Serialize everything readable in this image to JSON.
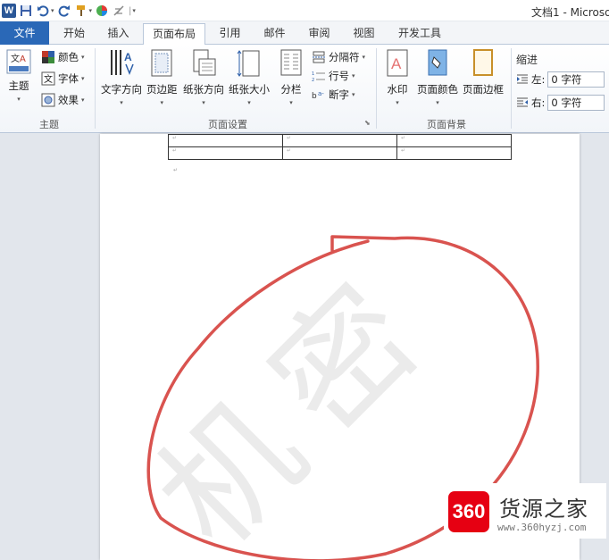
{
  "titlebar": {
    "title": "文档1 - Microso"
  },
  "tabs": [
    {
      "label": "文件"
    },
    {
      "label": "开始"
    },
    {
      "label": "插入"
    },
    {
      "label": "页面布局"
    },
    {
      "label": "引用"
    },
    {
      "label": "邮件"
    },
    {
      "label": "审阅"
    },
    {
      "label": "视图"
    },
    {
      "label": "开发工具"
    }
  ],
  "ribbon": {
    "theme_group": {
      "label": "主题",
      "theme": "主题",
      "colors": "颜色",
      "fonts": "字体",
      "effects": "效果"
    },
    "page_setup": {
      "label": "页面设置",
      "text_direction": "文字方向",
      "margins": "页边距",
      "orientation": "纸张方向",
      "size": "纸张大小",
      "columns": "分栏",
      "breaks": "分隔符",
      "line_numbers": "行号",
      "hyphenation": "断字"
    },
    "page_background": {
      "label": "页面背景",
      "watermark": "水印",
      "page_color": "页面颜色",
      "page_borders": "页面边框"
    },
    "indent": {
      "title": "缩进",
      "left_label": "左:",
      "left_value": "0 字符",
      "right_label": "右:",
      "right_value": "0 字符"
    }
  },
  "document": {
    "watermark_text": "机密"
  },
  "brand": {
    "badge": "360",
    "name": "货源之家",
    "url": "www.360hyzj.com"
  },
  "colors": {
    "file_tab": "#2a68b7",
    "annotation": "#d9534f",
    "brand": "#e60012"
  }
}
